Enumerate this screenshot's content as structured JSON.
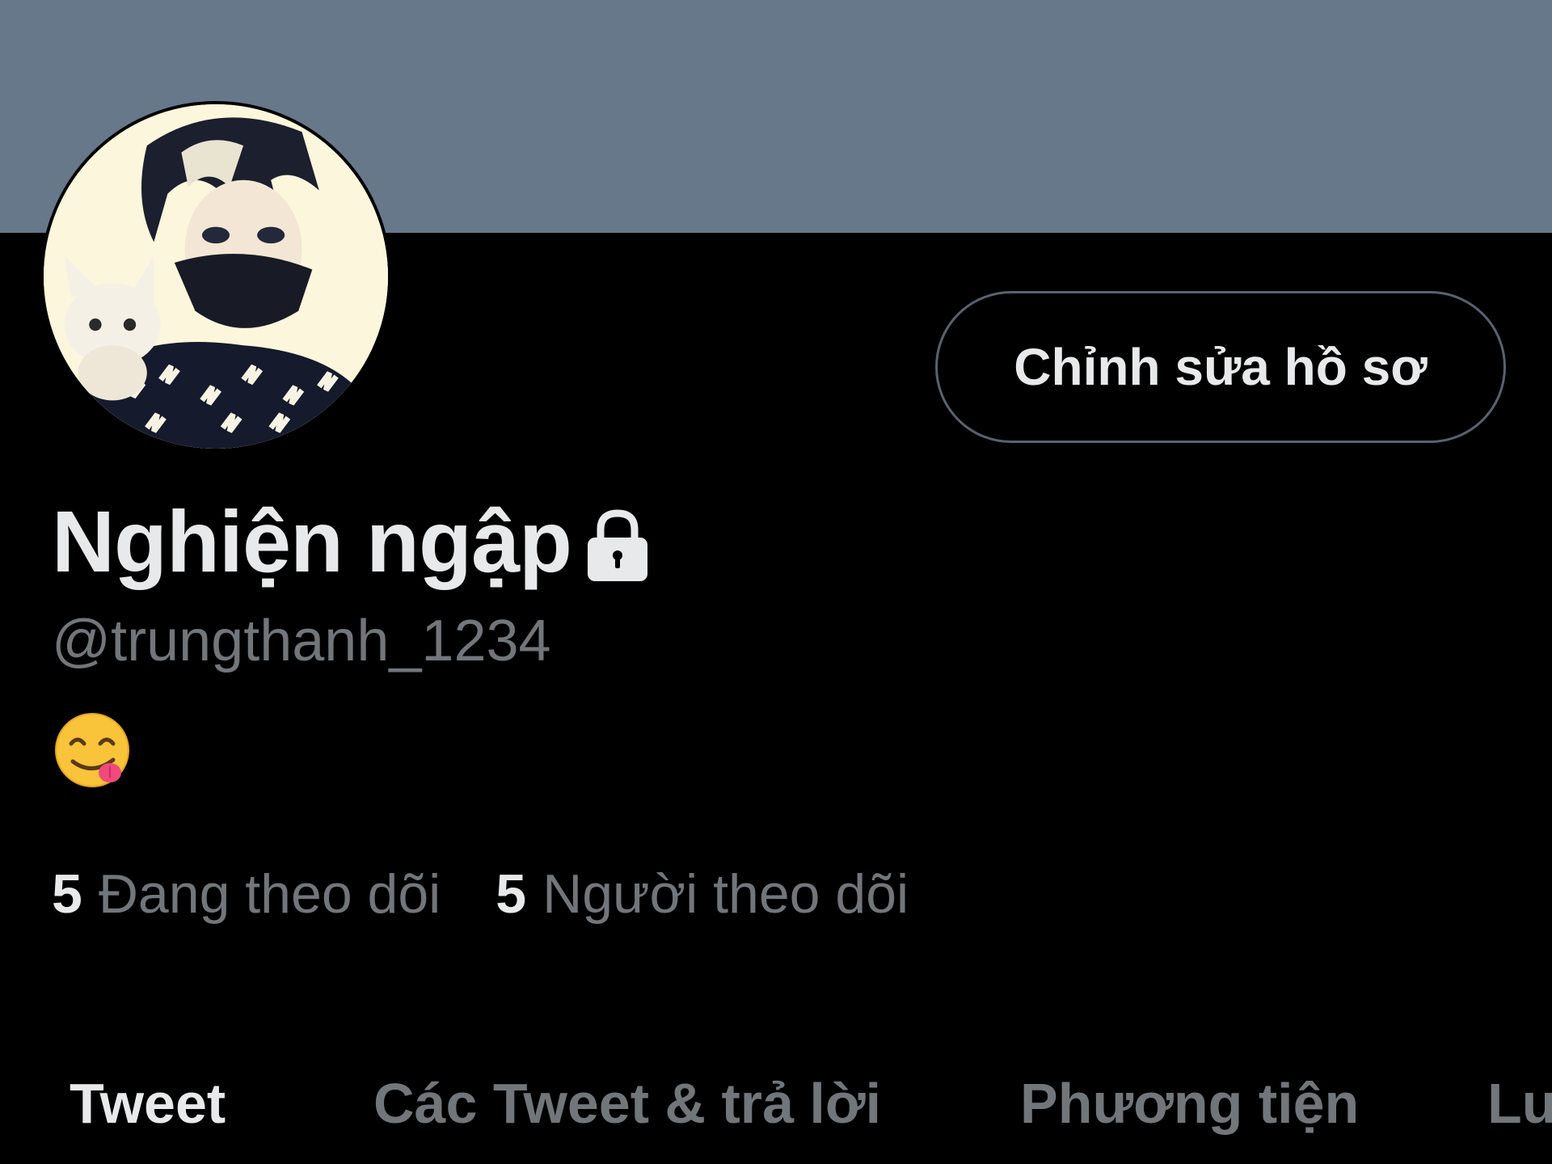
{
  "profile": {
    "display_name": "Nghiện ngập",
    "handle": "@trungthanh_1234",
    "bio_emoji": "yum-face-emoji",
    "locked_icon": "lock-icon",
    "avatar_icon": "avatar-image"
  },
  "actions": {
    "edit_profile_label": "Chỉnh sửa hồ sơ"
  },
  "stats": {
    "following_count": "5",
    "following_label": "Đang theo dõi",
    "followers_count": "5",
    "followers_label": "Người theo dõi"
  },
  "tabs": [
    {
      "label": "Tweet",
      "active": true
    },
    {
      "label": "Các Tweet & trả lời",
      "active": false
    },
    {
      "label": "Phương tiện",
      "active": false
    },
    {
      "label": "Lu",
      "active": false
    }
  ],
  "colors": {
    "banner": "#66788a",
    "background": "#000000",
    "primary_text": "#e7e9ea",
    "secondary_text": "#71767b",
    "button_border": "#536471"
  }
}
